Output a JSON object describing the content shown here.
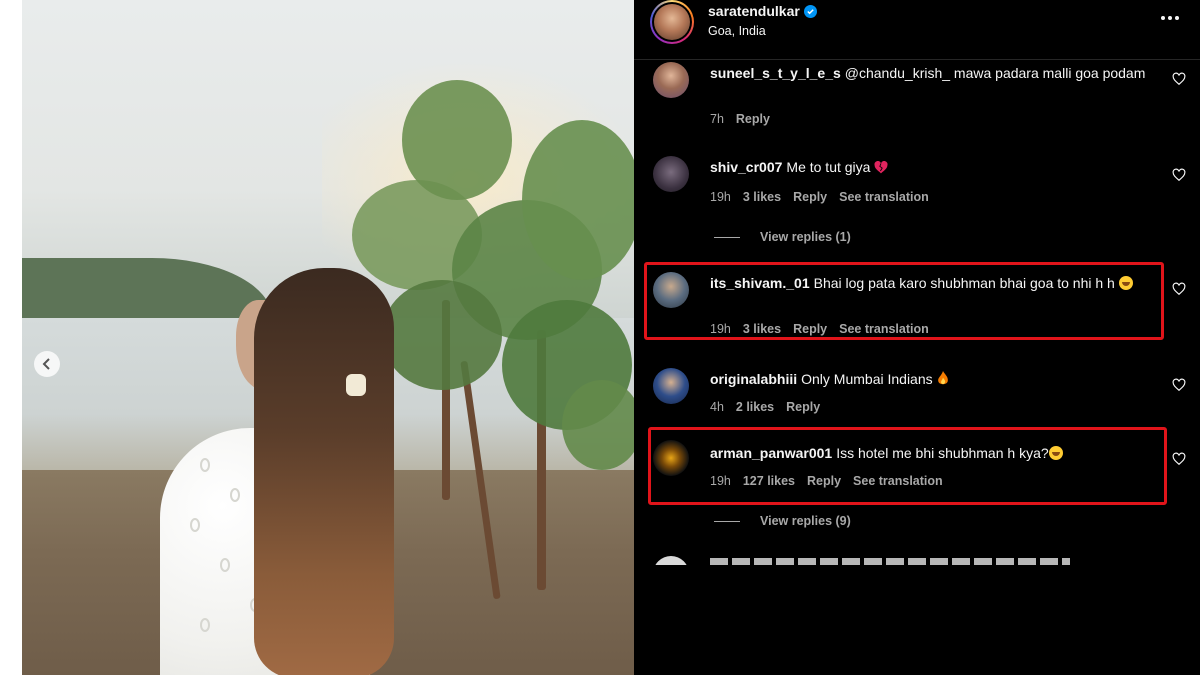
{
  "post": {
    "username": "saratendulkar",
    "location": "Goa, India",
    "verified": true
  },
  "comments": [
    {
      "username": "suneel_s_t_y_l_e_s",
      "text": "@chandu_krish_ mawa padara malli goa podam",
      "time": "7h",
      "likes": "",
      "reply": "Reply",
      "translation": ""
    },
    {
      "username": "shiv_cr007",
      "text": "Me to tut giya",
      "time": "19h",
      "likes": "3 likes",
      "reply": "Reply",
      "translation": "See translation",
      "view_replies": "View replies (1)",
      "emoji": "broken-heart"
    },
    {
      "username": "its_shivam._01",
      "text": "Bhai log pata karo shubhman bhai goa to nhi h h",
      "time": "19h",
      "likes": "3 likes",
      "reply": "Reply",
      "translation": "See translation",
      "emoji": "laughing-face",
      "highlighted": true
    },
    {
      "username": "originalabhiii",
      "text": "Only Mumbai Indians",
      "time": "4h",
      "likes": "2 likes",
      "reply": "Reply",
      "translation": "",
      "emoji": "fire"
    },
    {
      "username": "arman_panwar001",
      "text": "Iss hotel me bhi shubhman h kya?",
      "time": "19h",
      "likes": "127 likes",
      "reply": "Reply",
      "translation": "See translation",
      "view_replies": "View replies (9)",
      "emoji": "laughing-face",
      "highlighted": true
    }
  ],
  "colors": {
    "background": "#000000",
    "text": "#f5f5f5",
    "muted": "#a8a8a8",
    "verified": "#0095f6",
    "highlight": "#e0141a"
  }
}
